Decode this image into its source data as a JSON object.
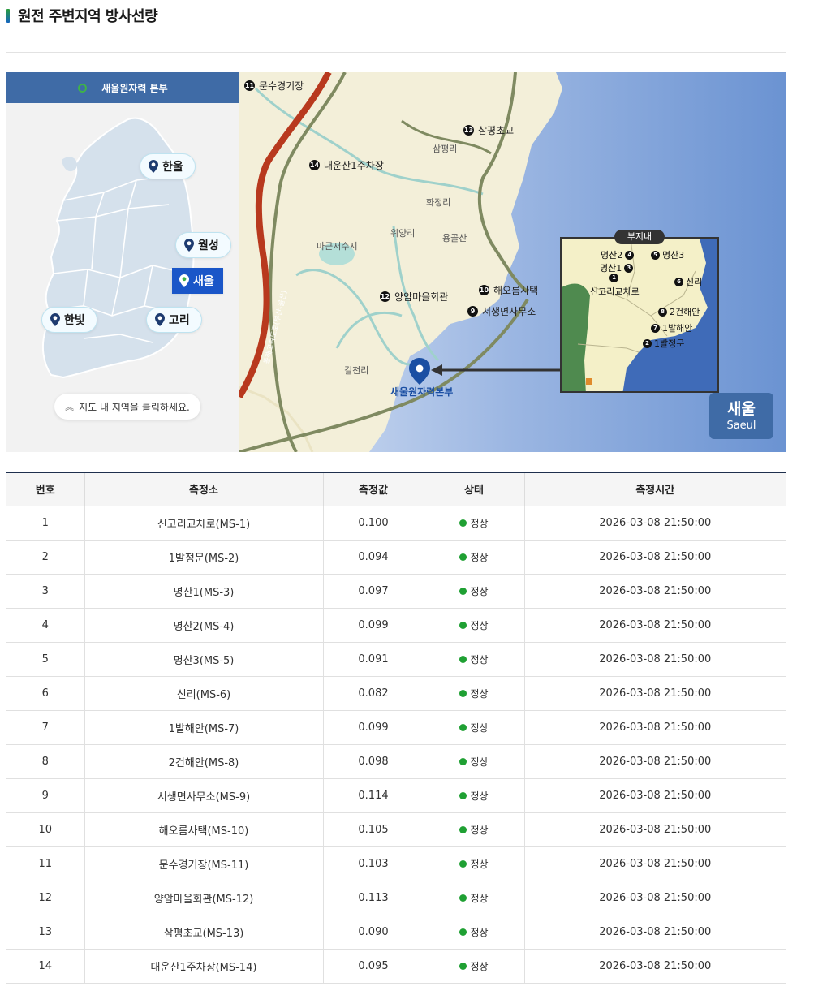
{
  "page_title": "원전 주변지역 방사선량",
  "left_panel": {
    "header": "새울원자력 본부",
    "sites": [
      {
        "label": "한울",
        "active": false
      },
      {
        "label": "월성",
        "active": false
      },
      {
        "label": "새울",
        "active": true
      },
      {
        "label": "한빛",
        "active": false
      },
      {
        "label": "고리",
        "active": false
      }
    ],
    "hint": "지도 내 지역을 클릭하세요."
  },
  "map": {
    "stations": [
      {
        "num": "11",
        "label": "문수경기장"
      },
      {
        "num": "13",
        "label": "삼평초교"
      },
      {
        "num": "14",
        "label": "대운산1주차장"
      },
      {
        "num": "12",
        "label": "양암마을회관"
      },
      {
        "num": "10",
        "label": "해오름사택"
      },
      {
        "num": "9",
        "label": "서생면사무소"
      }
    ],
    "places": [
      "삼평리",
      "화정리",
      "위양리",
      "용골산",
      "마근저수지",
      "길천리"
    ],
    "hq_label": "새울원자력본부",
    "road_label": "동해고속도로(부산-울산)",
    "inset": {
      "title": "부지내",
      "stations": [
        {
          "num": "4",
          "label": "명산2"
        },
        {
          "num": "5",
          "label": "명산3"
        },
        {
          "num": "3",
          "label": "명산1"
        },
        {
          "num": "1",
          "label": "신고리교차로"
        },
        {
          "num": "6",
          "label": "신리"
        },
        {
          "num": "8",
          "label": "2건해안"
        },
        {
          "num": "7",
          "label": "1발해안"
        },
        {
          "num": "2",
          "label": "1발정문"
        }
      ]
    },
    "badge": {
      "ko": "새울",
      "en": "Saeul"
    }
  },
  "table": {
    "headers": [
      "번호",
      "측정소",
      "측정값",
      "상태",
      "측정시간"
    ],
    "rows": [
      {
        "no": "1",
        "station": "신고리교차로(MS-1)",
        "value": "0.100",
        "status": "정상",
        "time": "2026-03-08 21:50:00"
      },
      {
        "no": "2",
        "station": "1발정문(MS-2)",
        "value": "0.094",
        "status": "정상",
        "time": "2026-03-08 21:50:00"
      },
      {
        "no": "3",
        "station": "명산1(MS-3)",
        "value": "0.097",
        "status": "정상",
        "time": "2026-03-08 21:50:00"
      },
      {
        "no": "4",
        "station": "명산2(MS-4)",
        "value": "0.099",
        "status": "정상",
        "time": "2026-03-08 21:50:00"
      },
      {
        "no": "5",
        "station": "명산3(MS-5)",
        "value": "0.091",
        "status": "정상",
        "time": "2026-03-08 21:50:00"
      },
      {
        "no": "6",
        "station": "신리(MS-6)",
        "value": "0.082",
        "status": "정상",
        "time": "2026-03-08 21:50:00"
      },
      {
        "no": "7",
        "station": "1발해안(MS-7)",
        "value": "0.099",
        "status": "정상",
        "time": "2026-03-08 21:50:00"
      },
      {
        "no": "8",
        "station": "2건해안(MS-8)",
        "value": "0.098",
        "status": "정상",
        "time": "2026-03-08 21:50:00"
      },
      {
        "no": "9",
        "station": "서생면사무소(MS-9)",
        "value": "0.114",
        "status": "정상",
        "time": "2026-03-08 21:50:00"
      },
      {
        "no": "10",
        "station": "해오름사택(MS-10)",
        "value": "0.105",
        "status": "정상",
        "time": "2026-03-08 21:50:00"
      },
      {
        "no": "11",
        "station": "문수경기장(MS-11)",
        "value": "0.103",
        "status": "정상",
        "time": "2026-03-08 21:50:00"
      },
      {
        "no": "12",
        "station": "양암마을회관(MS-12)",
        "value": "0.113",
        "status": "정상",
        "time": "2026-03-08 21:50:00"
      },
      {
        "no": "13",
        "station": "삼평초교(MS-13)",
        "value": "0.090",
        "status": "정상",
        "time": "2026-03-08 21:50:00"
      },
      {
        "no": "14",
        "station": "대운산1주차장(MS-14)",
        "value": "0.095",
        "status": "정상",
        "time": "2026-03-08 21:50:00"
      }
    ]
  },
  "colors": {
    "header_blue": "#3f6ba6",
    "active_site": "#1a56c8",
    "status_ok": "#1fa033",
    "table_top": "#1e2f4d"
  }
}
